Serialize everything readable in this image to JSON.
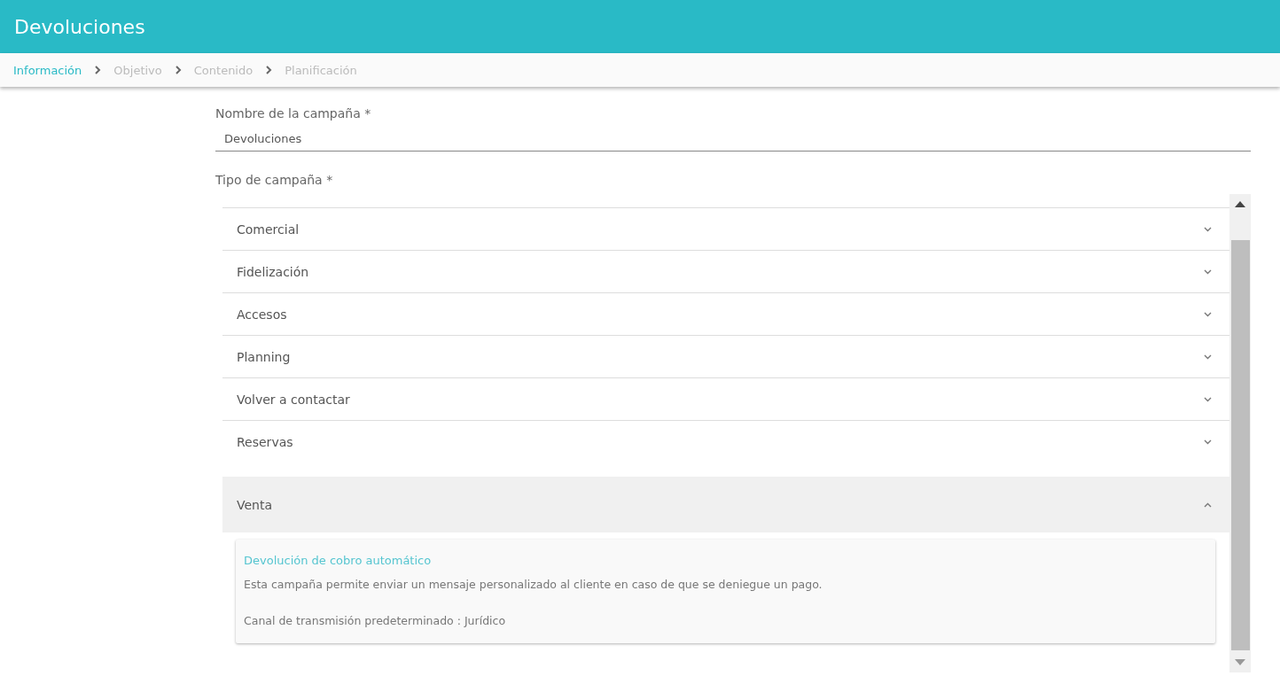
{
  "header": {
    "title": "Devoluciones"
  },
  "steps": [
    {
      "label": "Información",
      "selected": true
    },
    {
      "label": "Objetivo",
      "selected": false
    },
    {
      "label": "Contenido",
      "selected": false
    },
    {
      "label": "Planificación",
      "selected": false
    }
  ],
  "name_field": {
    "label": "Nombre de la campaña *",
    "value": "Devoluciones"
  },
  "type_section": {
    "label": "Tipo de campaña *"
  },
  "campaign_types": [
    {
      "label": "Comercial",
      "expanded": false
    },
    {
      "label": "Fidelización",
      "expanded": false
    },
    {
      "label": "Accesos",
      "expanded": false
    },
    {
      "label": "Planning",
      "expanded": false
    },
    {
      "label": "Volver a contactar",
      "expanded": false
    },
    {
      "label": "Reservas",
      "expanded": false
    },
    {
      "label": "Venta",
      "expanded": true,
      "options": [
        {
          "title": "Devolución de cobro automático",
          "description": "Esta campaña permite enviar un mensaje personalizado al cliente en caso de que se deniegue un pago.",
          "channel": "Canal de transmisión predeterminado : Jurídico"
        }
      ]
    }
  ]
}
